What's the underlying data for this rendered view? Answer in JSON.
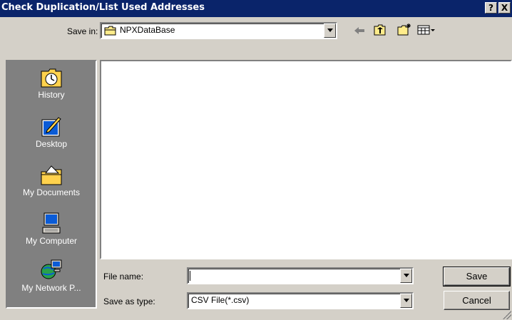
{
  "window": {
    "title": "Check Duplication/List Used Addresses",
    "help_glyph": "?",
    "close_glyph": "X"
  },
  "save_in": {
    "label": "Save in:",
    "value": "NPXDataBase"
  },
  "toolbar": {
    "icons": [
      "back-arrow-icon",
      "up-folder-icon",
      "new-folder-icon",
      "view-menu-icon"
    ]
  },
  "places": [
    {
      "label": "History",
      "icon": "history-icon"
    },
    {
      "label": "Desktop",
      "icon": "desktop-icon"
    },
    {
      "label": "My Documents",
      "icon": "my-documents-icon"
    },
    {
      "label": "My Computer",
      "icon": "my-computer-icon"
    },
    {
      "label": "My Network P...",
      "icon": "my-network-places-icon"
    }
  ],
  "file_name": {
    "label": "File name:",
    "value": ""
  },
  "save_as_type": {
    "label": "Save as type:",
    "value": "CSV File(*.csv)"
  },
  "buttons": {
    "save": "Save",
    "cancel": "Cancel"
  }
}
